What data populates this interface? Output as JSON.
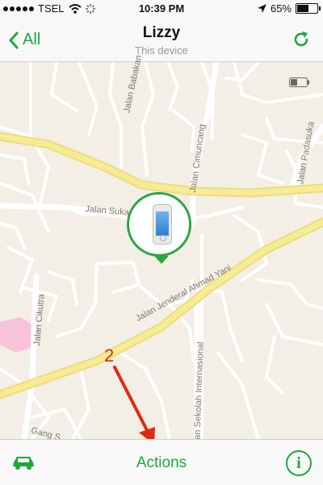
{
  "status_bar": {
    "carrier": "TSEL",
    "time": "10:39 PM",
    "battery_text": "65%",
    "battery_level": 0.65
  },
  "nav": {
    "back_label": "All",
    "title": "Lizzy",
    "subtitle": "This device"
  },
  "map": {
    "streets": {
      "babakan": "Jalan Babakan",
      "cimuncang": "Jalan Cimuncang",
      "padasuka": "Jalan Padasuka",
      "sukarajin": "Jalan Sukarajin",
      "ahmad_yani": "Jalan Jenderal Ahmad Yani",
      "cikutra": "Jalan Cikutra",
      "sekolah_internasional": "Jalan Sekolah Internasional",
      "gang": "Gang S"
    },
    "device_battery_level": 0.4,
    "annotation_number": "2"
  },
  "toolbar": {
    "actions_label": "Actions",
    "info_label": "i"
  },
  "colors": {
    "accent": "#1da83c",
    "pin": "#2aa645",
    "annotation": "#e02a12",
    "road_major": "#f6ea8e"
  },
  "icons": {
    "signal": "signal-dots-icon",
    "wifi": "wifi-icon",
    "activity": "activity-spinner-icon",
    "location": "location-arrow-icon",
    "battery": "battery-icon",
    "back": "chevron-left-icon",
    "refresh": "refresh-icon",
    "car": "car-icon",
    "info": "info-icon"
  }
}
